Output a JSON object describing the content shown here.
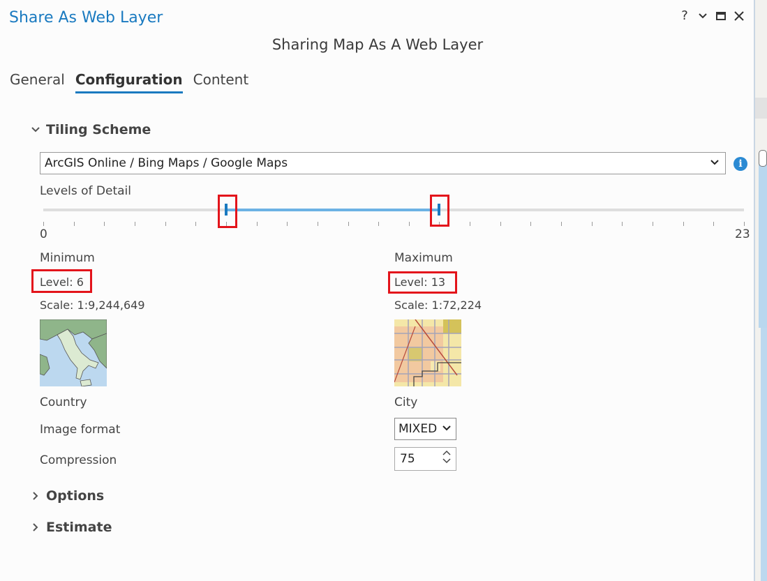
{
  "window": {
    "title": "Share As Web Layer",
    "help": "?"
  },
  "header": {
    "subtitle": "Sharing Map As A Web Layer"
  },
  "tabs": [
    {
      "label": "General"
    },
    {
      "label": "Configuration",
      "active": true
    },
    {
      "label": "Content"
    }
  ],
  "tiling": {
    "section_label": "Tiling Scheme",
    "scheme_value": "ArcGIS Online / Bing Maps / Google Maps",
    "levels_label": "Levels of Detail",
    "slider": {
      "min": 0,
      "max": 23,
      "low": 6,
      "high": 13,
      "min_label": "0",
      "max_label": "23"
    },
    "minimum": {
      "heading": "Minimum",
      "level": "Level:  6",
      "scale": "Scale:  1:9,244,649",
      "caption": "Country"
    },
    "maximum": {
      "heading": "Maximum",
      "level": "Level:  13",
      "scale": "Scale:  1:72,224",
      "caption": "City"
    },
    "image_format": {
      "label": "Image format",
      "value": "MIXED"
    },
    "compression": {
      "label": "Compression",
      "value": "75"
    }
  },
  "sections": {
    "options": "Options",
    "estimate": "Estimate"
  },
  "colors": {
    "accent": "#1a7ac0",
    "highlight": "#e3141b",
    "range": "#6cb2e4"
  }
}
